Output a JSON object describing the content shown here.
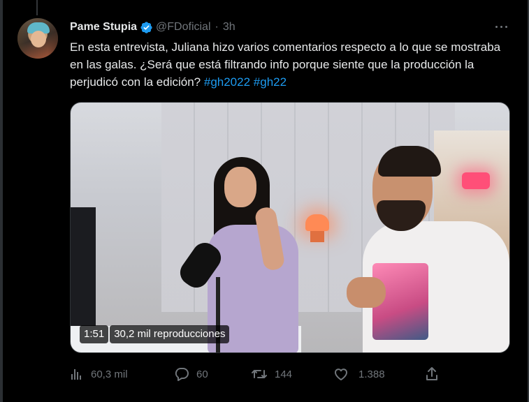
{
  "tweet": {
    "author_name": "Pame Stupia",
    "handle": "@FDoficial",
    "separator": "·",
    "time": "3h",
    "text": "En esta entrevista, Juliana hizo varios comentarios respecto a lo que se mostraba en las galas. ¿Será que está filtrando info porque siente que la producción la perjudicó con la edición? ",
    "hashtags": [
      "#gh2022",
      "#gh22"
    ]
  },
  "video": {
    "duration": "1:51",
    "views": "30,2 mil reproducciones"
  },
  "actions": {
    "views_count": "60,3 mil",
    "replies_count": "60",
    "retweets_count": "144",
    "likes_count": "1.388"
  },
  "colors": {
    "background": "#000000",
    "text": "#e7e9ea",
    "secondary": "#71767b",
    "accent": "#1d9bf0"
  },
  "icons": [
    "verified-badge-icon",
    "more-options-icon",
    "analytics-icon",
    "reply-icon",
    "retweet-icon",
    "like-icon",
    "share-icon"
  ]
}
